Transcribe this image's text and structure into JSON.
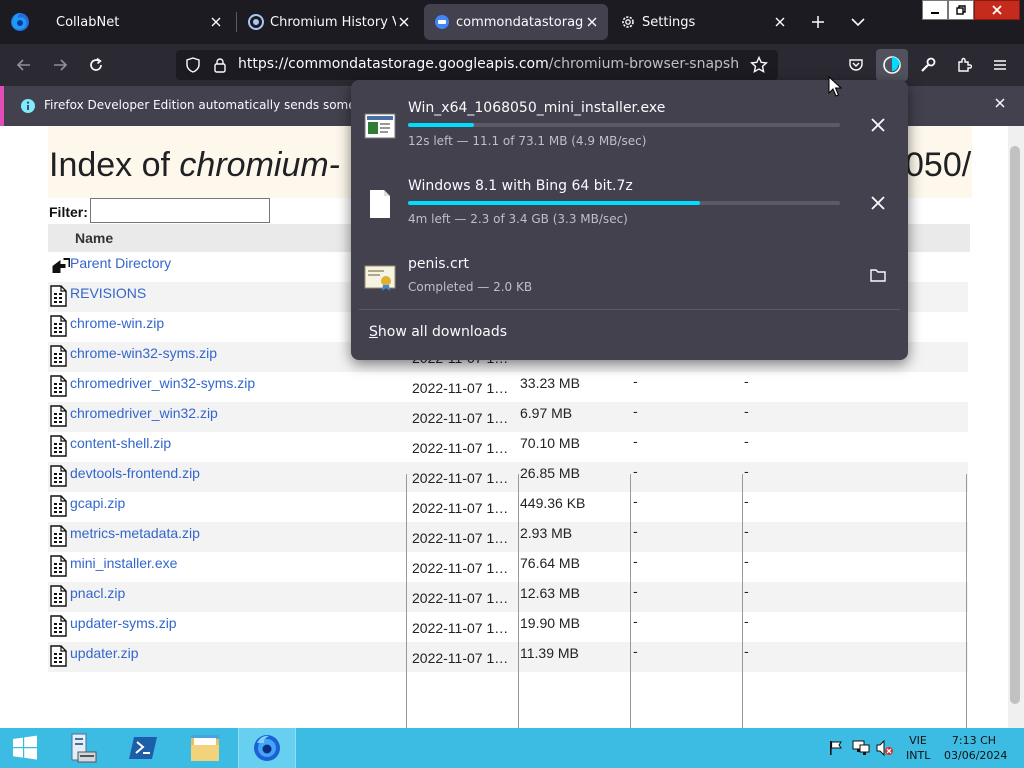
{
  "browser": {
    "tabs": [
      {
        "title": "CollabNet",
        "active": false
      },
      {
        "title": "Chromium History Versi",
        "active": false
      },
      {
        "title": "commondatastorage.go",
        "active": true
      },
      {
        "title": "Settings",
        "active": false
      }
    ],
    "url": {
      "host": "https://commondatastorage.googleapis.com",
      "path": "/chromium-browser-snapshots/index"
    },
    "notification": "Firefox Developer Edition automatically sends some data to"
  },
  "page": {
    "heading_prefix": "Index of ",
    "heading_em": "chromium-",
    "heading_tail": "050/",
    "filter_label": "Filter:",
    "filter_value": "",
    "column_name": "Name",
    "parent_directory": "Parent Directory",
    "rows": [
      {
        "name": "REVISIONS",
        "date": "",
        "size": "",
        "c4": "",
        "c5": ""
      },
      {
        "name": "chrome-win.zip",
        "date": "",
        "size": "",
        "c4": "",
        "c5": ""
      },
      {
        "name": "chrome-win32-syms.zip",
        "date": "2022-11-07 1…",
        "size": "",
        "c4": "",
        "c5": ""
      },
      {
        "name": "chromedriver_win32-syms.zip",
        "date": "2022-11-07 1…",
        "size": "33.23 MB",
        "c4": "-",
        "c5": "-"
      },
      {
        "name": "chromedriver_win32.zip",
        "date": "2022-11-07 1…",
        "size": "6.97 MB",
        "c4": "-",
        "c5": "-"
      },
      {
        "name": "content-shell.zip",
        "date": "2022-11-07 1…",
        "size": "70.10 MB",
        "c4": "-",
        "c5": "-"
      },
      {
        "name": "devtools-frontend.zip",
        "date": "2022-11-07 1…",
        "size": "26.85 MB",
        "c4": "-",
        "c5": "-"
      },
      {
        "name": "gcapi.zip",
        "date": "2022-11-07 1…",
        "size": "449.36 KB",
        "c4": "-",
        "c5": "-"
      },
      {
        "name": "metrics-metadata.zip",
        "date": "2022-11-07 1…",
        "size": "2.93 MB",
        "c4": "-",
        "c5": "-"
      },
      {
        "name": "mini_installer.exe",
        "date": "2022-11-07 1…",
        "size": "76.64 MB",
        "c4": "-",
        "c5": "-"
      },
      {
        "name": "pnacl.zip",
        "date": "2022-11-07 1…",
        "size": "12.63 MB",
        "c4": "-",
        "c5": "-"
      },
      {
        "name": "updater-syms.zip",
        "date": "2022-11-07 1…",
        "size": "19.90 MB",
        "c4": "-",
        "c5": "-"
      },
      {
        "name": "updater.zip",
        "date": "2022-11-07 1…",
        "size": "11.39 MB",
        "c4": "-",
        "c5": "-"
      }
    ]
  },
  "downloads": {
    "items": [
      {
        "name": "Win_x64_1068050_mini_installer.exe",
        "status": "12s left — 11.1 of 73.1 MB (4.9 MB/sec)",
        "progress": 0.152,
        "icon": "installer-file-icon",
        "action": "cancel-icon"
      },
      {
        "name": "Windows 8.1 with Bing 64 bit.7z",
        "status": "4m left — 2.3 of 3.4 GB (3.3 MB/sec)",
        "progress": 0.676,
        "icon": "blank-file-icon",
        "action": "cancel-icon"
      },
      {
        "name": "penis.crt",
        "status": "Completed — 2.0 KB",
        "progress": null,
        "icon": "certificate-file-icon",
        "action": "folder-icon"
      }
    ],
    "show_all_prefix": "S",
    "show_all_rest": "how all downloads"
  },
  "taskbar": {
    "language": [
      "VIE",
      "INTL"
    ],
    "time": "7:13 CH",
    "date": "03/06/2024"
  },
  "colors": {
    "accent": "#00ddff",
    "notification_stripe": "#e24db8",
    "link": "#3366cc",
    "taskbar": "#3dbce3"
  }
}
